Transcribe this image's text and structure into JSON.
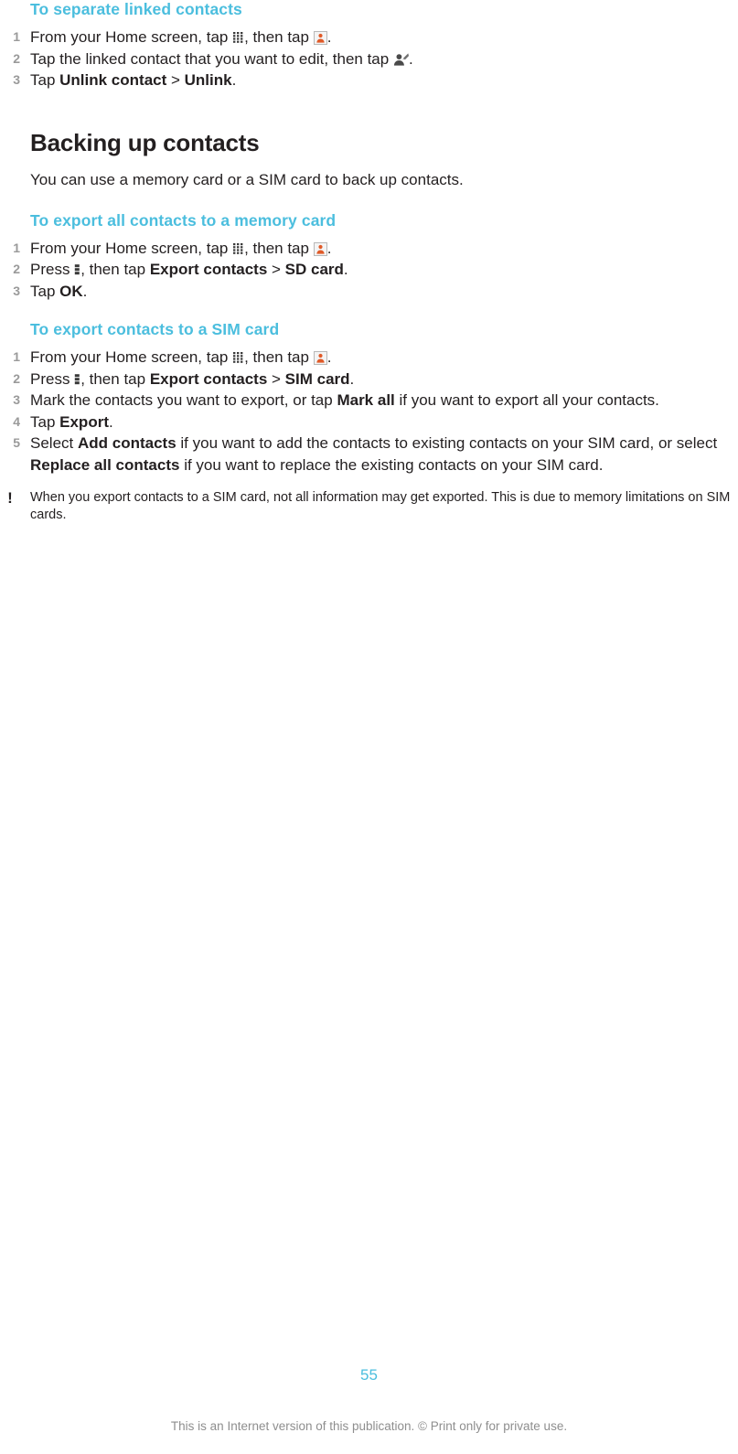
{
  "document": {
    "page_number": "55",
    "footer_note": "This is an Internet version of this publication. © Print only for private use.",
    "accent_color": "#4bbede",
    "text_color": "#231f20",
    "step_number_color": "#9a9a9a",
    "footer_color": "#8e8e8e"
  },
  "sections": {
    "separate_linked": {
      "heading": "To separate linked contacts",
      "steps": [
        {
          "num": "1",
          "parts": [
            {
              "type": "text",
              "value": "From your Home screen, tap "
            },
            {
              "type": "icon",
              "value": "app-grid-icon"
            },
            {
              "type": "text",
              "value": ", then tap "
            },
            {
              "type": "icon",
              "value": "contacts-icon"
            },
            {
              "type": "text",
              "value": "."
            }
          ]
        },
        {
          "num": "2",
          "parts": [
            {
              "type": "text",
              "value": "Tap the linked contact that you want to edit, then tap "
            },
            {
              "type": "icon",
              "value": "edit-contact-icon"
            },
            {
              "type": "text",
              "value": "."
            }
          ]
        },
        {
          "num": "3",
          "parts": [
            {
              "type": "text",
              "value": "Tap "
            },
            {
              "type": "bold",
              "value": "Unlink contact"
            },
            {
              "type": "text",
              "value": " > "
            },
            {
              "type": "bold",
              "value": "Unlink"
            },
            {
              "type": "text",
              "value": "."
            }
          ]
        }
      ]
    },
    "backing_up": {
      "heading": "Backing up contacts",
      "intro": "You can use a memory card or a SIM card to back up contacts."
    },
    "export_memory_card": {
      "heading": "To export all contacts to a memory card",
      "steps": [
        {
          "num": "1",
          "parts": [
            {
              "type": "text",
              "value": "From your Home screen, tap "
            },
            {
              "type": "icon",
              "value": "app-grid-icon"
            },
            {
              "type": "text",
              "value": ", then tap "
            },
            {
              "type": "icon",
              "value": "contacts-icon"
            },
            {
              "type": "text",
              "value": "."
            }
          ]
        },
        {
          "num": "2",
          "parts": [
            {
              "type": "text",
              "value": "Press "
            },
            {
              "type": "icon",
              "value": "menu-key-icon"
            },
            {
              "type": "text",
              "value": ", then tap "
            },
            {
              "type": "bold",
              "value": "Export contacts"
            },
            {
              "type": "text",
              "value": " > "
            },
            {
              "type": "bold",
              "value": "SD card"
            },
            {
              "type": "text",
              "value": "."
            }
          ]
        },
        {
          "num": "3",
          "parts": [
            {
              "type": "text",
              "value": "Tap "
            },
            {
              "type": "bold",
              "value": "OK"
            },
            {
              "type": "text",
              "value": "."
            }
          ]
        }
      ]
    },
    "export_sim_card": {
      "heading": "To export contacts to a SIM card",
      "steps": [
        {
          "num": "1",
          "parts": [
            {
              "type": "text",
              "value": "From your Home screen, tap "
            },
            {
              "type": "icon",
              "value": "app-grid-icon"
            },
            {
              "type": "text",
              "value": ", then tap "
            },
            {
              "type": "icon",
              "value": "contacts-icon"
            },
            {
              "type": "text",
              "value": "."
            }
          ]
        },
        {
          "num": "2",
          "parts": [
            {
              "type": "text",
              "value": "Press "
            },
            {
              "type": "icon",
              "value": "menu-key-icon"
            },
            {
              "type": "text",
              "value": ", then tap "
            },
            {
              "type": "bold",
              "value": "Export contacts"
            },
            {
              "type": "text",
              "value": " > "
            },
            {
              "type": "bold",
              "value": "SIM card"
            },
            {
              "type": "text",
              "value": "."
            }
          ]
        },
        {
          "num": "3",
          "parts": [
            {
              "type": "text",
              "value": "Mark the contacts you want to export, or tap "
            },
            {
              "type": "bold",
              "value": "Mark all"
            },
            {
              "type": "text",
              "value": " if you want to export all your contacts."
            }
          ]
        },
        {
          "num": "4",
          "parts": [
            {
              "type": "text",
              "value": "Tap "
            },
            {
              "type": "bold",
              "value": "Export"
            },
            {
              "type": "text",
              "value": "."
            }
          ]
        },
        {
          "num": "5",
          "parts": [
            {
              "type": "text",
              "value": "Select "
            },
            {
              "type": "bold",
              "value": "Add contacts"
            },
            {
              "type": "text",
              "value": " if you want to add the contacts to existing contacts on your SIM card, or select "
            },
            {
              "type": "bold",
              "value": "Replace all contacts"
            },
            {
              "type": "text",
              "value": " if you want to replace the existing contacts on your SIM card."
            }
          ]
        }
      ],
      "note": {
        "icon": "exclamation-icon",
        "text": "When you export contacts to a SIM card, not all information may get exported. This is due to memory limitations on SIM cards."
      }
    }
  }
}
